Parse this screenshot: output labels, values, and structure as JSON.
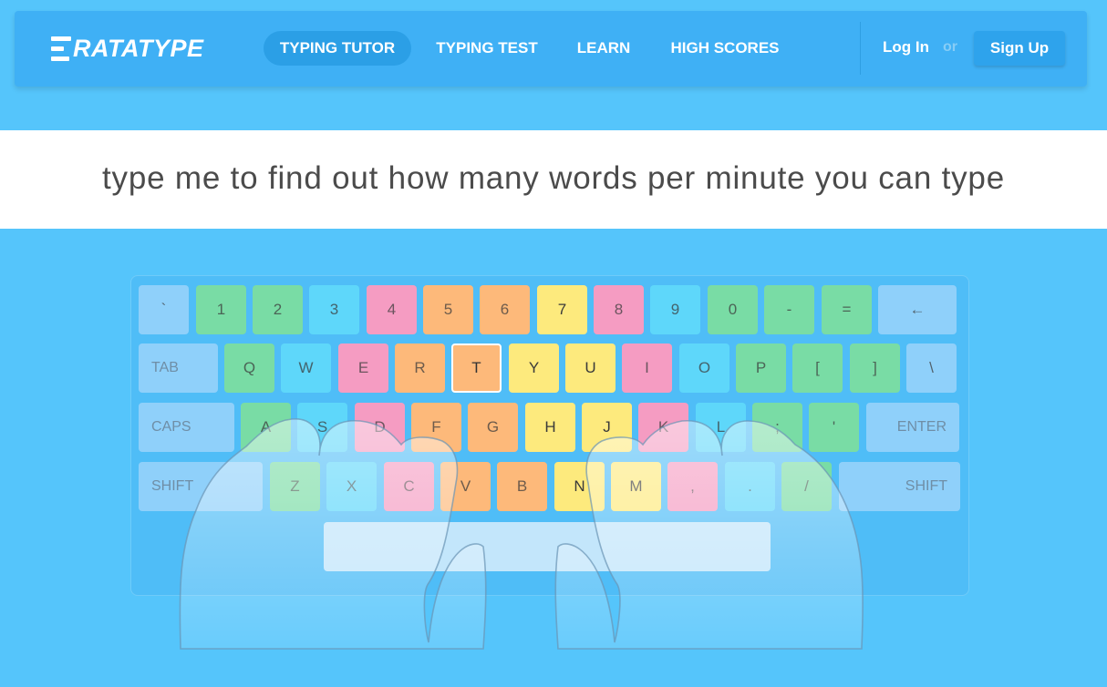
{
  "header": {
    "logo_text": "RATATYPE",
    "nav": [
      {
        "label": "TYPING TUTOR",
        "active": true
      },
      {
        "label": "TYPING TEST",
        "active": false
      },
      {
        "label": "LEARN",
        "active": false
      },
      {
        "label": "HIGH SCORES",
        "active": false
      }
    ],
    "login_label": "Log In",
    "or_label": "or",
    "signup_label": "Sign Up"
  },
  "typing": {
    "text": "type me to find out how many words per minute you can type"
  },
  "keyboard": {
    "row1": [
      "`",
      "1",
      "2",
      "3",
      "4",
      "5",
      "6",
      "7",
      "8",
      "9",
      "0",
      "-",
      "=",
      "←"
    ],
    "row2": [
      "TAB",
      "Q",
      "W",
      "E",
      "R",
      "T",
      "Y",
      "U",
      "I",
      "O",
      "P",
      "[",
      "]",
      "\\"
    ],
    "row3": [
      "CAPS",
      "A",
      "S",
      "D",
      "F",
      "G",
      "H",
      "J",
      "K",
      "L",
      ";",
      "'",
      "ENTER"
    ],
    "row4": [
      "SHIFT",
      "Z",
      "X",
      "C",
      "V",
      "B",
      "N",
      "M",
      ",",
      ".",
      "/",
      "SHIFT"
    ],
    "active_key": "T"
  },
  "colors": {
    "background": "#55c5fb",
    "header": "#3fb0f5",
    "active_nav": "#2b9fe6",
    "key_blue": "#8fd0fa",
    "key_green": "#79dca5",
    "key_cyan": "#5ed7fa",
    "key_pink": "#f59cc2",
    "key_orange": "#fdb97a",
    "key_yellow": "#fdea7d"
  }
}
